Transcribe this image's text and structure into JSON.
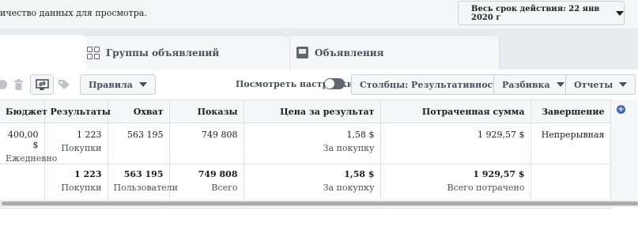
{
  "topbar": {
    "hint": "ичество данных для просмотра.",
    "period_label": "Весь срок действия: 22 янв 2020 г"
  },
  "tabs": [
    {
      "label": "Группы объявлений",
      "icon": "grid-icon"
    },
    {
      "label": "Объявления",
      "icon": "ad-icon"
    }
  ],
  "toolbar": {
    "rules": "Правила",
    "view_settings": "Посмотреть настройки",
    "columns": "Столбцы: Результативность",
    "breakdown": "Разбивка",
    "reports": "Отчеты"
  },
  "table": {
    "headers": [
      "Бюджет",
      "Результаты",
      "Охват",
      "Показы",
      "Цена за результат",
      "Потраченная сумма",
      "Завершение"
    ],
    "row": {
      "budget": "400,00 $",
      "budget_sub": "Ежедневно",
      "results": "1 223",
      "results_sub": "Покупки",
      "reach": "563 195",
      "impressions": "749 808",
      "cost": "1,58 $",
      "cost_sub": "За покупку",
      "spent": "1 929,57 $",
      "end": "Непрерывная"
    },
    "total": {
      "results": "1 223",
      "results_sub": "Покупки",
      "reach": "563 195",
      "reach_sub": "Пользователи",
      "impressions": "749 808",
      "impressions_sub": "Всего",
      "cost": "1,58 $",
      "cost_sub": "За покупку",
      "spent": "1 929,57 $",
      "spent_sub": "Всего потрачено"
    }
  }
}
